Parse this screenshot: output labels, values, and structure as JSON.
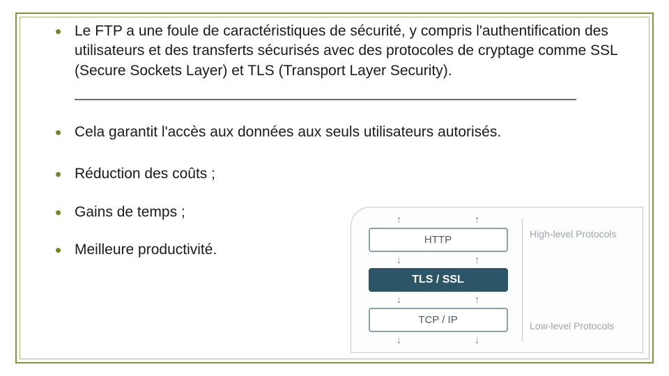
{
  "bullets": {
    "b1": "Le FTP a une foule de caractéristiques de sécurité, y compris l'authentification des utilisateurs et des transferts sécurisés avec des protocoles de cryptage comme SSL (Secure Sockets Layer) et TLS (Transport Layer Security).",
    "b2": "Cela garantit l'accès aux données aux seuls utilisateurs autorisés.",
    "b3": "Réduction des coûts ;",
    "b4": "Gains de temps ;",
    "b5": "Meilleure productivité."
  },
  "diagram": {
    "layers": {
      "top": "HTTP",
      "mid": "TLS / SSL",
      "bot": "TCP / IP"
    },
    "labels": {
      "high": "High-level Protocols",
      "low": "Low-level Protocols"
    }
  },
  "colors": {
    "bullet": "#6b8e23",
    "border": "#7a9a3a",
    "tlsbox": "#2d5568"
  }
}
